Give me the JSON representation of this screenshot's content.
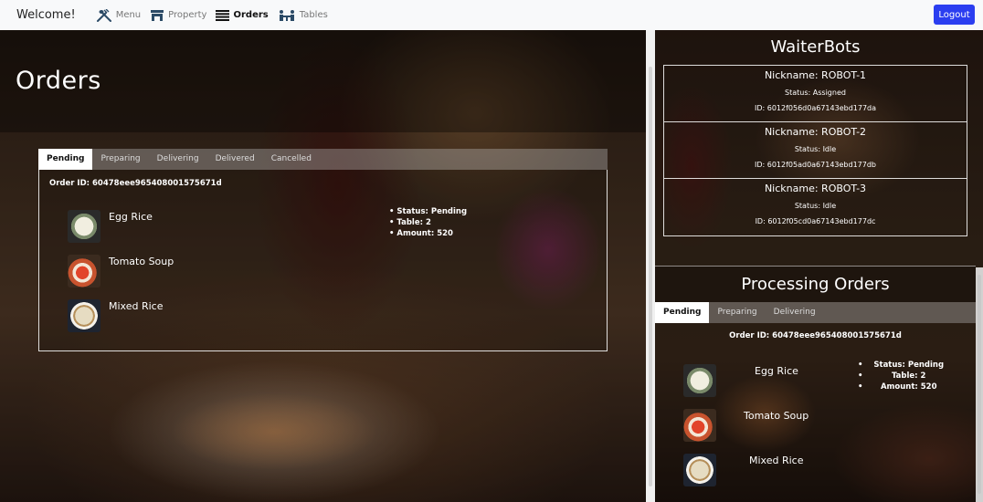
{
  "nav": {
    "brand": "Welcome!",
    "links": [
      {
        "label": "Menu",
        "icon": "utensils-icon",
        "active": false
      },
      {
        "label": "Property",
        "icon": "store-icon",
        "active": false
      },
      {
        "label": "Orders",
        "icon": "list-icon",
        "active": true
      },
      {
        "label": "Tables",
        "icon": "table-icon",
        "active": false
      }
    ],
    "logout_label": "Logout",
    "logout_color": "#2b3ef0"
  },
  "orders_page": {
    "title": "Orders",
    "tabs": [
      "Pending",
      "Preparing",
      "Delivering",
      "Delivered",
      "Cancelled"
    ],
    "active_tab": "Pending",
    "order": {
      "id_text": "Order ID: 60478eee965408001575671d",
      "items": [
        {
          "name": "Egg Rice",
          "thumb": "egg-rice-thumbnail"
        },
        {
          "name": "Tomato Soup",
          "thumb": "tomato-soup-thumbnail"
        },
        {
          "name": "Mixed Rice",
          "thumb": "mixed-rice-thumbnail"
        }
      ],
      "status": "Status: Pending",
      "table": "Table: 2",
      "amount": "Amount: 520"
    }
  },
  "waiterbots": {
    "title": "WaiterBots",
    "bots": [
      {
        "nickname": "Nickname: ROBOT-1",
        "status": "Status: Assigned",
        "id": "ID: 6012f056d0a67143ebd177da"
      },
      {
        "nickname": "Nickname: ROBOT-2",
        "status": "Status: Idle",
        "id": "ID: 6012f05ad0a67143ebd177db"
      },
      {
        "nickname": "Nickname: ROBOT-3",
        "status": "Status: Idle",
        "id": "ID: 6012f05cd0a67143ebd177dc"
      }
    ]
  },
  "processing_orders": {
    "title": "Processing Orders",
    "tabs": [
      "Pending",
      "Preparing",
      "Delivering"
    ],
    "active_tab": "Pending",
    "order": {
      "id_text": "Order ID: 60478eee965408001575671d",
      "items": [
        {
          "name": "Egg Rice",
          "thumb": "egg-rice-thumbnail"
        },
        {
          "name": "Tomato Soup",
          "thumb": "tomato-soup-thumbnail"
        },
        {
          "name": "Mixed Rice",
          "thumb": "mixed-rice-thumbnail"
        }
      ],
      "status": "Status: Pending",
      "table": "Table: 2",
      "amount": "Amount: 520"
    }
  }
}
